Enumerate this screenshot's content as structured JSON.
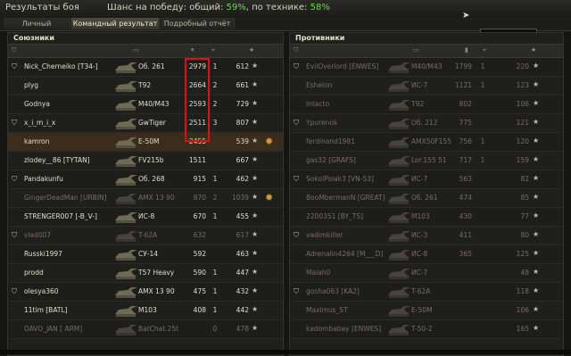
{
  "window": {
    "title": "Результаты боя",
    "chance_label": "Шанс на победу: общий:",
    "chance_total": "59%",
    "chance_sep": ", по технике:",
    "chance_vehicles": "58%"
  },
  "tooltip": "Результаты боя",
  "tabs": [
    {
      "label": "Личный результат",
      "active": false
    },
    {
      "label": "Командный результат",
      "active": true
    },
    {
      "label": "Подробный отчёт",
      "active": false
    }
  ],
  "allies": {
    "title": "Союзники",
    "rows": [
      {
        "name": "Nick_Cherneiko [T34-]",
        "vehicle": "Об. 261",
        "damage": "2979",
        "kills": "1",
        "exp": "612",
        "dead": false,
        "medal": false
      },
      {
        "name": "plyg",
        "vehicle": "T92",
        "damage": "2664",
        "kills": "2",
        "exp": "661",
        "dead": false,
        "medal": false
      },
      {
        "name": "Godnya",
        "vehicle": "M40/M43",
        "damage": "2593",
        "kills": "2",
        "exp": "729",
        "dead": false,
        "medal": false
      },
      {
        "name": "x_i_m_i_x",
        "vehicle": "GwTiger",
        "damage": "2511",
        "kills": "3",
        "exp": "807",
        "dead": false,
        "medal": false
      },
      {
        "name": "kamron",
        "vehicle": "E-50M",
        "damage": "2455",
        "kills": "",
        "exp": "539",
        "dead": false,
        "medal": true,
        "self": true
      },
      {
        "name": "zlodey__86 [TYTAN]",
        "vehicle": "FV215b",
        "damage": "1511",
        "kills": "",
        "exp": "667",
        "dead": false,
        "medal": false
      },
      {
        "name": "Pandakunfu",
        "vehicle": "Об. 268",
        "damage": "915",
        "kills": "1",
        "exp": "462",
        "dead": false,
        "medal": false
      },
      {
        "name": "GingerDeadMan [URBIN]",
        "vehicle": "AMX 13 90",
        "damage": "870",
        "kills": "2",
        "exp": "1039",
        "dead": true,
        "medal": true
      },
      {
        "name": "STRENGER007 [-B_V-]",
        "vehicle": "ИС-8",
        "damage": "670",
        "kills": "1",
        "exp": "455",
        "dead": false,
        "medal": false
      },
      {
        "name": "vlad007",
        "vehicle": "T-62A",
        "damage": "632",
        "kills": "",
        "exp": "617",
        "dead": true,
        "medal": false
      },
      {
        "name": "Russki1997",
        "vehicle": "СУ-14",
        "damage": "592",
        "kills": "",
        "exp": "463",
        "dead": false,
        "medal": false
      },
      {
        "name": "prodd",
        "vehicle": "T57 Heavy",
        "damage": "590",
        "kills": "1",
        "exp": "447",
        "dead": false,
        "medal": false
      },
      {
        "name": "olesya360",
        "vehicle": "AMX 13 90",
        "damage": "475",
        "kills": "1",
        "exp": "432",
        "dead": false,
        "medal": false
      },
      {
        "name": "11tim [BATL]",
        "vehicle": "M103",
        "damage": "408",
        "kills": "1",
        "exp": "442",
        "dead": false,
        "medal": false
      },
      {
        "name": "DAVO_JAN [ ARM]",
        "vehicle": "BatChat.25t",
        "damage": "",
        "kills": "0",
        "exp": "478",
        "dead": true,
        "medal": false
      }
    ]
  },
  "enemies": {
    "title": "Противники",
    "rows": [
      {
        "name": "EvilOverlord [ENWES]",
        "vehicle": "M40/M43",
        "damage": "1799",
        "kills": "1",
        "exp": "220",
        "dead": true
      },
      {
        "name": "Eshelon",
        "vehicle": "ИС-7",
        "damage": "1121",
        "kills": "1",
        "exp": "123",
        "dead": true
      },
      {
        "name": "Intacto",
        "vehicle": "T92",
        "damage": "802",
        "kills": "",
        "exp": "106",
        "dead": true
      },
      {
        "name": "Ypurenok",
        "vehicle": "Об. 212",
        "damage": "775",
        "kills": "",
        "exp": "121",
        "dead": true
      },
      {
        "name": "ferdinand1981",
        "vehicle": "AMX50F155",
        "damage": "756",
        "kills": "1",
        "exp": "120",
        "dead": true
      },
      {
        "name": "gas32 [GRAFS]",
        "vehicle": "Lor.155 51",
        "damage": "717",
        "kills": "1",
        "exp": "159",
        "dead": true
      },
      {
        "name": "SokolPolak3 [VN-53]",
        "vehicle": "ИС-7",
        "damage": "563",
        "kills": "",
        "exp": "82",
        "dead": true
      },
      {
        "name": "BooMbermanN [GREAT]",
        "vehicle": "Об. 261",
        "damage": "474",
        "kills": "",
        "exp": "85",
        "dead": true
      },
      {
        "name": "2200351 [BY_TS]",
        "vehicle": "M103",
        "damage": "430",
        "kills": "",
        "exp": "77",
        "dead": true
      },
      {
        "name": "vadimkiller",
        "vehicle": "ИС-3",
        "damage": "411",
        "kills": "",
        "exp": "80",
        "dead": true
      },
      {
        "name": "Adrenalin4264 [M___D]",
        "vehicle": "ИС-8",
        "damage": "365",
        "kills": "",
        "exp": "125",
        "dead": true
      },
      {
        "name": "Malah0",
        "vehicle": "ИС-7",
        "damage": "",
        "kills": "",
        "exp": "48",
        "dead": true
      },
      {
        "name": "gosha063 [KA2]",
        "vehicle": "T-62A",
        "damage": "",
        "kills": "",
        "exp": "118",
        "dead": true
      },
      {
        "name": "Maximus_ST",
        "vehicle": "E-50M",
        "damage": "",
        "kills": "",
        "exp": "106",
        "dead": true
      },
      {
        "name": "kadombabay [ENWES]",
        "vehicle": "T-50-2",
        "damage": "",
        "kills": "",
        "exp": "165",
        "dead": true
      }
    ]
  }
}
